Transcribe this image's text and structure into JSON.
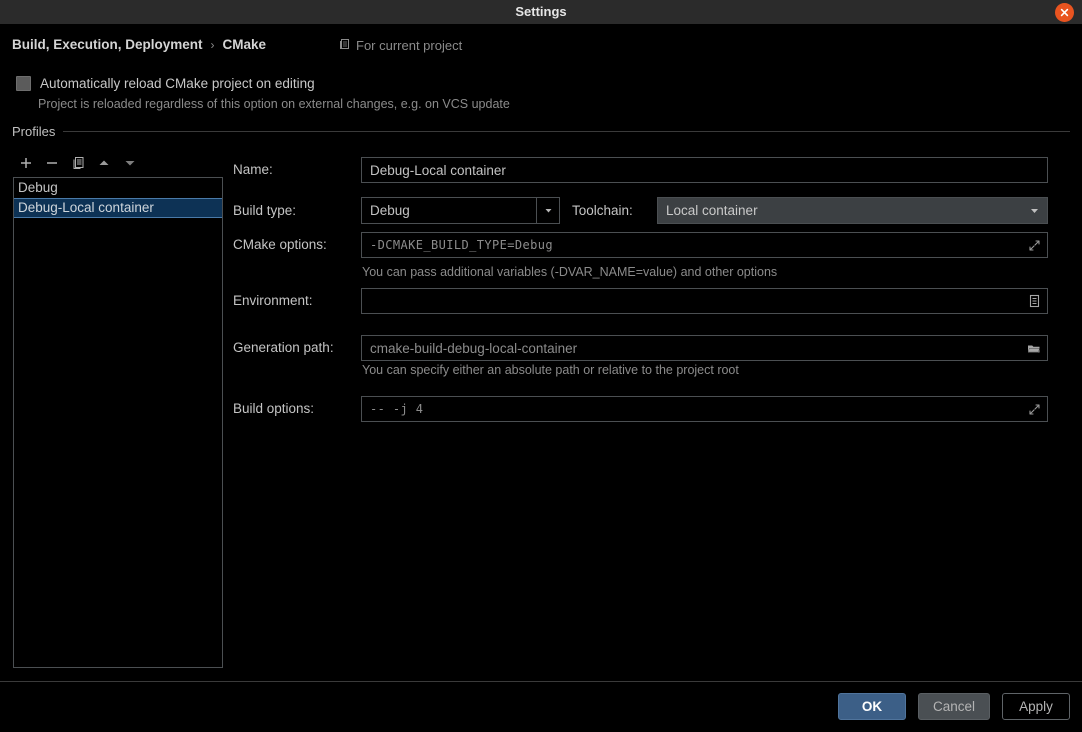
{
  "window": {
    "title": "Settings",
    "close_icon": "close-icon",
    "accent_close": "#e95420"
  },
  "breadcrumb": {
    "root": "Build, Execution, Deployment",
    "separator": "›",
    "current": "CMake",
    "scope_icon": "copy-icon",
    "scope_label": "For current project"
  },
  "auto_reload": {
    "label": "Automatically reload CMake project on editing",
    "hint": "Project is reloaded regardless of this option on external changes, e.g. on VCS update",
    "checked": false
  },
  "profiles": {
    "group_title": "Profiles",
    "toolbar": [
      {
        "name": "add-profile-button",
        "icon": "plus-icon"
      },
      {
        "name": "remove-profile-button",
        "icon": "minus-icon"
      },
      {
        "name": "copy-profile-button",
        "icon": "copy-icon"
      },
      {
        "name": "move-up-button",
        "icon": "arrow-up-icon"
      },
      {
        "name": "move-down-button",
        "icon": "arrow-down-icon"
      }
    ],
    "items": [
      {
        "label": "Debug",
        "selected": false
      },
      {
        "label": "Debug-Local container",
        "selected": true
      }
    ],
    "selection_color": "#0d3255"
  },
  "form": {
    "name": {
      "label": "Name:",
      "value": "Debug-Local container"
    },
    "build_type": {
      "label": "Build type:",
      "value": "Debug"
    },
    "toolchain": {
      "label": "Toolchain:",
      "value": "Local container"
    },
    "cmake_options": {
      "label": "CMake options:",
      "value": "-DCMAKE_BUILD_TYPE=Debug",
      "hint": "You can pass additional variables (-DVAR_NAME=value) and other options",
      "expand_icon": "expand-icon"
    },
    "environment": {
      "label": "Environment:",
      "value": "",
      "browse_icon": "list-icon"
    },
    "generation_path": {
      "label": "Generation path:",
      "value": "cmake-build-debug-local-container",
      "hint": "You can specify either an absolute path or relative to the project root",
      "browse_icon": "folder-icon"
    },
    "build_options": {
      "label": "Build options:",
      "value": "--  -j  4",
      "expand_icon": "expand-icon"
    }
  },
  "footer": {
    "ok": "OK",
    "cancel": "Cancel",
    "apply": "Apply",
    "ok_color": "#3c5f87"
  }
}
